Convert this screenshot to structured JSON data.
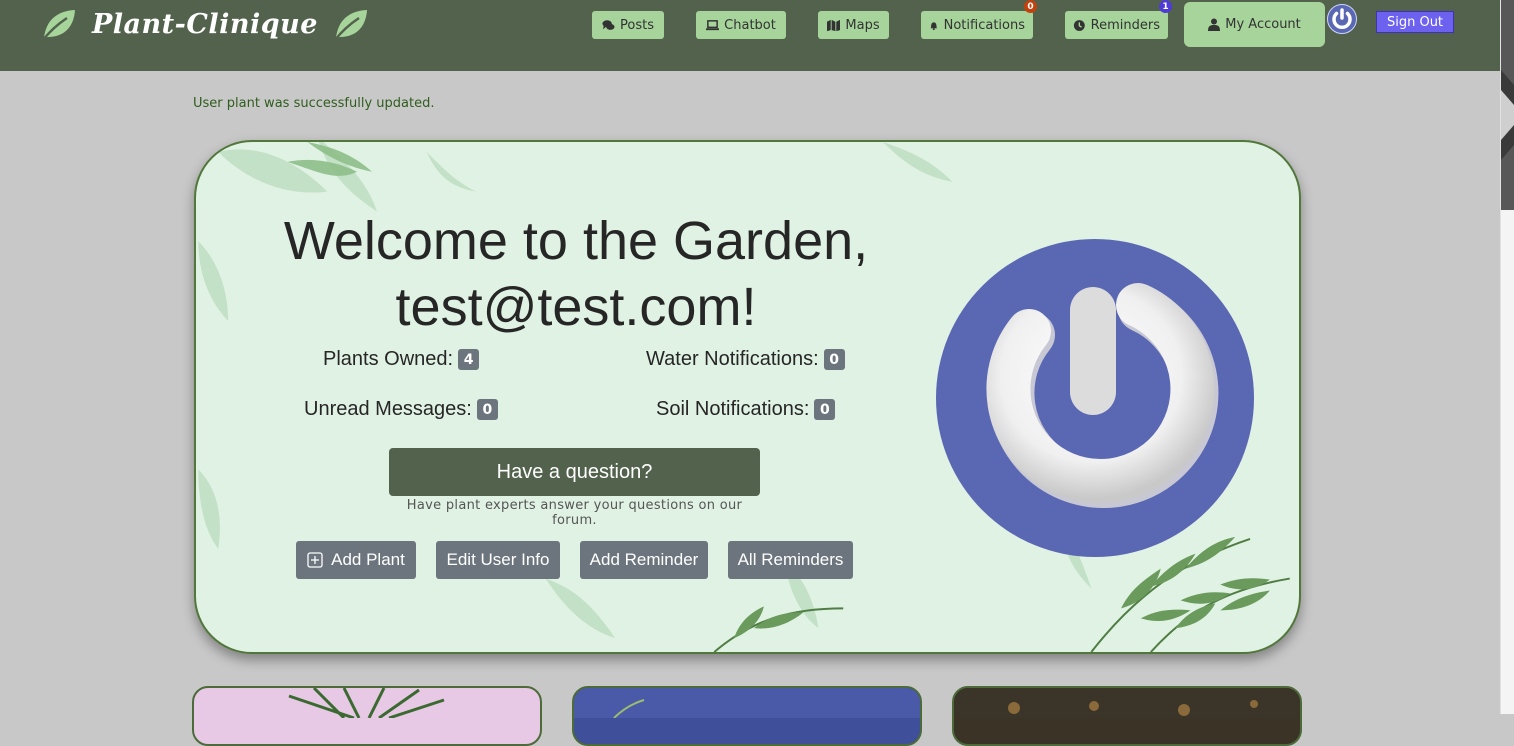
{
  "brand": {
    "name": "Plant-Clinique",
    "leaf_icon": "leaf-icon"
  },
  "nav": {
    "posts": "Posts",
    "chatbot": "Chatbot",
    "maps": "Maps",
    "notifications": "Notifications",
    "notifications_count": "0",
    "reminders": "Reminders",
    "reminders_count": "1",
    "my_account": "My Account",
    "sign_out": "Sign Out"
  },
  "flash": "User plant was successfully updated.",
  "hero": {
    "welcome_line1": "Welcome to the Garden,",
    "welcome_line2": "test@test.com!",
    "stats": {
      "plants_owned_label": "Plants Owned:",
      "plants_owned": "4",
      "water_notifications_label": "Water Notifications:",
      "water_notifications": "0",
      "unread_messages_label": "Unread Messages:",
      "unread_messages": "0",
      "soil_notifications_label": "Soil Notifications:",
      "soil_notifications": "0"
    },
    "question_button": "Have a question?",
    "question_sub": "Have plant experts answer your questions on our forum.",
    "actions": {
      "add_plant": "Add Plant",
      "edit_user_info": "Edit User Info",
      "add_reminder": "Add Reminder",
      "all_reminders": "All Reminders"
    }
  },
  "colors": {
    "navbar": "#52624c",
    "nav_button": "#a6d49b",
    "sign_out": "#6d62f0",
    "hero_bg": "#e0f2e3",
    "avatar": "#5a67b3",
    "badge": "#6c757d"
  }
}
